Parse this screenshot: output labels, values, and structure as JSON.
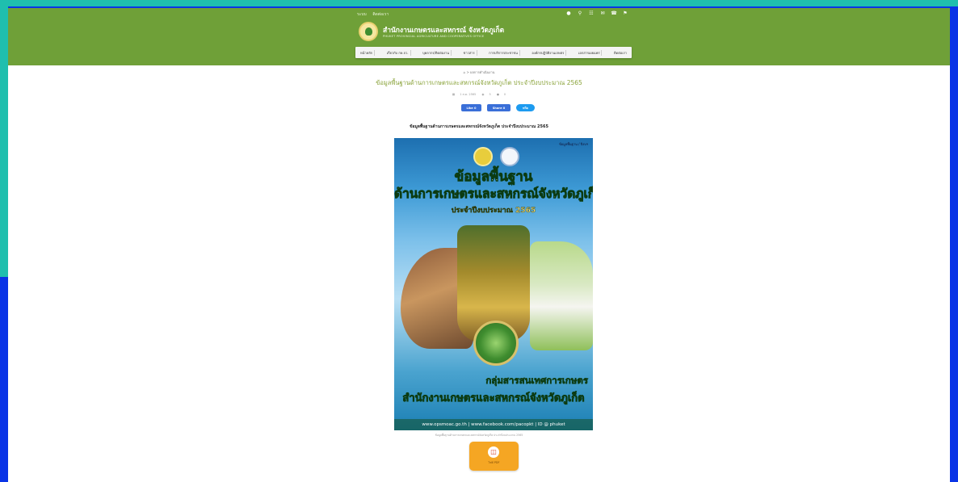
{
  "topbar": {
    "links": [
      "ระบบ",
      "ติดต่อเรา"
    ],
    "icons": [
      "user-icon",
      "search-icon",
      "sitemap-icon",
      "mail-icon",
      "phone-icon",
      "map-icon"
    ]
  },
  "site": {
    "title": "สำนักงานเกษตรและสหกรณ์ จังหวัดภูเก็ต",
    "subtitle": "PHUKET PROVINCIAL AGRICULTURE AND COOPERATIVES OFFICE"
  },
  "nav": {
    "items": [
      "หน้าหลัก",
      "เกี่ยวกับ กษ.จว.",
      "บุคลากร/ติดต่องาน",
      "ข่าวสาร",
      "การบริการประชาชน",
      "องค์กรปฏิบัติงานเกษตร",
      "เอกสารเผยแพร่",
      "ติดต่อเรา"
    ]
  },
  "breadcrumb": {
    "home_icon": "home-icon",
    "text": "ผลการดำเนินงาน"
  },
  "article": {
    "title": "ข้อมูลพื้นฐานด้านการเกษตรและสหกรณ์จังหวัดภูเก็ต ประจำปีงบประมาณ 2565",
    "date": "1 ส.ค. 2565",
    "views": "5",
    "comments": "0",
    "heading": "ข้อมูลพื้นฐานด้านการเกษตรและสหกรณ์จังหวัดภูเก็ต ประจำปีงบประมาณ 2565",
    "caption": "ข้อมูลพื้นฐานด้านการเกษตรและสหกรณ์จังหวัดภูเก็ต ประจำปีงบประมาณ 2565"
  },
  "share": {
    "like": "Like 0",
    "share": "Share 0",
    "tweet": "ทวีต"
  },
  "poster": {
    "badge": "ข้อมูลพื้นฐาน / ปีงบฯ",
    "line1": "ข้อมูลพื้นฐาน",
    "line2": "ด้านการเกษตรและสหกรณ์จังหวัดภูเก็ต",
    "line3": "ประจำปีงบประมาณ 2565",
    "line4": "กลุ่มสารสนเทศการเกษตร",
    "line5": "สำนักงานเกษตรและสหกรณ์จังหวัดภูเก็ต",
    "footer": "www.opsmoac.go.th | www.facebook.com/pacopkt | ID @ phuket"
  },
  "pdf": {
    "label": "ไฟล์ PDF",
    "icon": "pdf-icon"
  },
  "colors": {
    "header": "#6fa038",
    "frame": "#0a34e6",
    "outer": "#1fbfae",
    "pdf_button": "#f5a623",
    "title": "#8aa33a"
  }
}
